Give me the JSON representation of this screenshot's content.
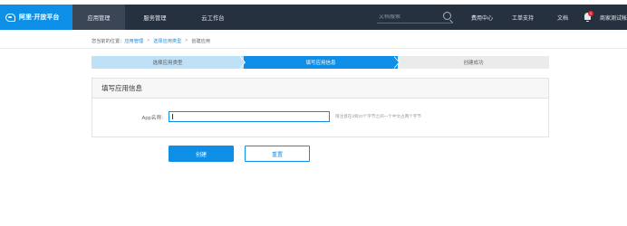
{
  "header": {
    "logo_text": "阿里·开放平台",
    "nav": [
      "应用管理",
      "服务管理",
      "云工作台"
    ],
    "search_placeholder": "文档搜索",
    "links": {
      "service_center": "费用中心",
      "support": "工单支持",
      "docs": "文档",
      "merchant": "商家测试帐"
    },
    "notification_count": "1",
    "colors": {
      "bar": "#26313f",
      "logo_bg": "#0e8fe7",
      "active_nav": "#3a4656"
    }
  },
  "breadcrumb": {
    "prefix": "您当前的位置：",
    "items": [
      "应用管理",
      "选择应用类型",
      "创建应用"
    ]
  },
  "steps": [
    "选择应用类型",
    "填写应用信息",
    "创建成功"
  ],
  "form": {
    "title": "填写应用信息",
    "app_name_label": "App名称:",
    "app_name_value": "",
    "app_name_hint": "限注意在3到20个字节之间一个中文占两个字节"
  },
  "buttons": {
    "create": "创建",
    "reset": "重置"
  },
  "accent_color": "#0e8fe7"
}
